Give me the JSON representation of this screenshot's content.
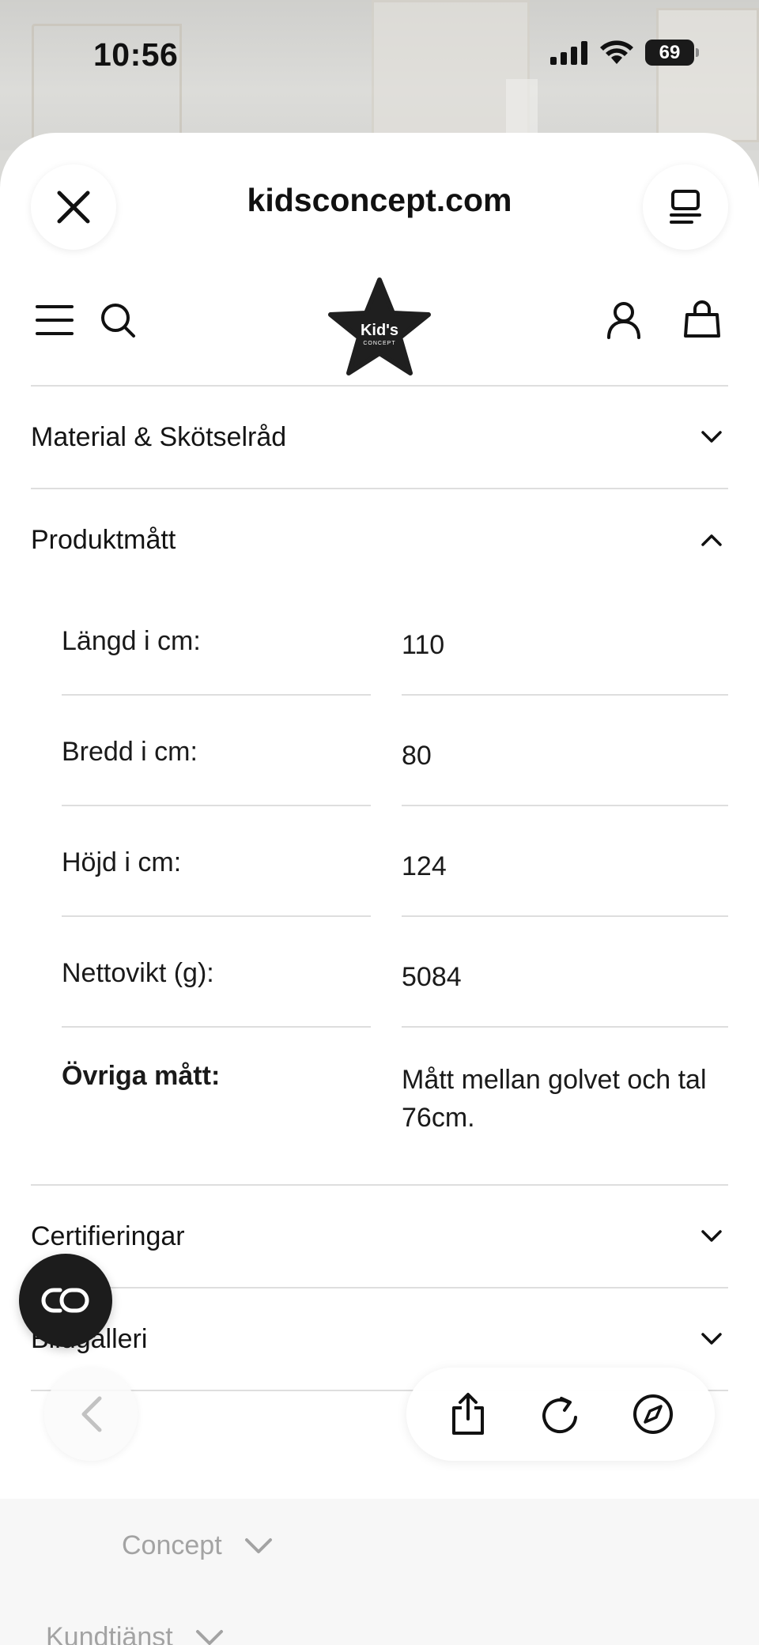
{
  "status_bar": {
    "time": "10:56",
    "battery": "69"
  },
  "browser": {
    "domain": "kidsconcept.com"
  },
  "site": {
    "logo_line1": "Kid's",
    "logo_line2": "CONCEPT"
  },
  "accordions": {
    "material": "Material & Skötselråd",
    "produktmatt": "Produktmått",
    "certifieringar": "Certifieringar",
    "bildgalleri": "Bildgalleri"
  },
  "specs": [
    {
      "key": "Längd i cm:",
      "value": "110"
    },
    {
      "key": "Bredd i cm:",
      "value": "80"
    },
    {
      "key": "Höjd i cm:",
      "value": "124"
    },
    {
      "key": "Nettovikt (g):",
      "value": "5084"
    },
    {
      "key": "Övriga mått:",
      "value": "Mått mellan golvet och tal 76cm."
    }
  ],
  "footer": {
    "about": "Concept",
    "kundtjanst": "Kundtjänst"
  },
  "colors": {
    "accent": "#1c1c1c",
    "divider": "#dedede"
  }
}
